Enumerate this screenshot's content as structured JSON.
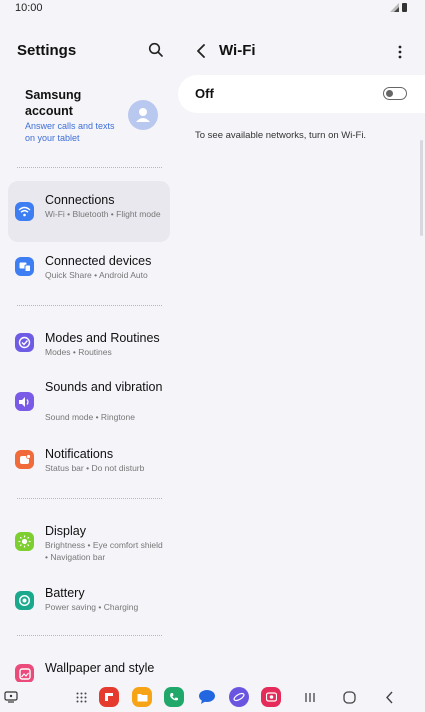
{
  "status": {
    "time": "10:00"
  },
  "settings": {
    "title": "Settings",
    "account": {
      "name": "Samsung account",
      "subtitle": "Answer calls and texts on your tablet"
    },
    "items": [
      {
        "label": "Connections",
        "desc": "Wi-Fi • Bluetooth • Flight mode",
        "icon": "wifi-icon",
        "color": "#3d7ef2"
      },
      {
        "label": "Connected devices",
        "desc": "Quick Share • Android Auto",
        "icon": "devices-icon",
        "color": "#3d7ef2"
      },
      {
        "label": "Modes and Routines",
        "desc": "Modes • Routines",
        "icon": "modes-icon",
        "color": "#6f5ce5"
      },
      {
        "label": "Sounds and vibration",
        "desc": "Sound mode • Ringtone",
        "icon": "volume-icon",
        "color": "#7a5be8"
      },
      {
        "label": "Notifications",
        "desc": "Status bar • Do not disturb",
        "icon": "notification-icon",
        "color": "#f06a3a"
      },
      {
        "label": "Display",
        "desc": "Brightness • Eye comfort shield • Navigation bar",
        "icon": "brightness-icon",
        "color": "#7ccf2e"
      },
      {
        "label": "Battery",
        "desc": "Power saving • Charging",
        "icon": "battery-icon",
        "color": "#1ba98e"
      },
      {
        "label": "Wallpaper and style",
        "desc": "",
        "icon": "wallpaper-icon",
        "color": "#ea4b7a"
      }
    ]
  },
  "wifi": {
    "title": "Wi-Fi",
    "switch_label": "Off",
    "switch_on": false,
    "hint": "To see available networks, turn on Wi-Fi."
  },
  "colors": {
    "background": "#f5f4f9",
    "accent": "#3e6fd8"
  }
}
